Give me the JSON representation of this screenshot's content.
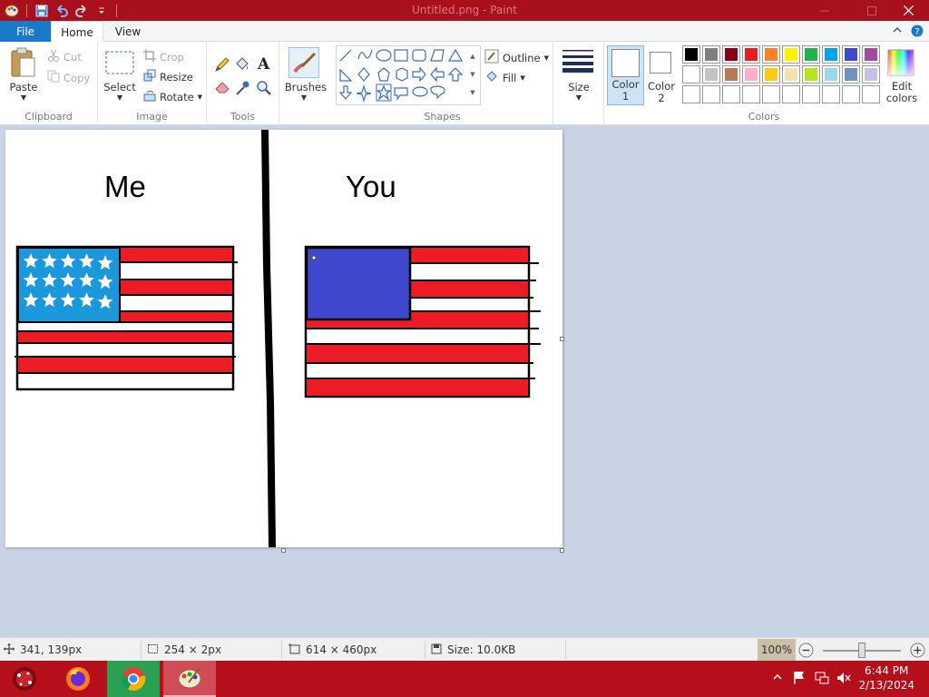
{
  "window": {
    "title": "Untitled.png - Paint",
    "controls": [
      "minimize",
      "maximize",
      "close"
    ]
  },
  "tabs": [
    {
      "label": "File"
    },
    {
      "label": "Home"
    },
    {
      "label": "View"
    }
  ],
  "ribbon": {
    "clipboard": {
      "label": "Clipboard",
      "paste": "Paste",
      "cut": "Cut",
      "copy": "Copy"
    },
    "image": {
      "label": "Image",
      "select": "Select",
      "crop": "Crop",
      "resize": "Resize",
      "rotate": "Rotate"
    },
    "tools": {
      "label": "Tools"
    },
    "brushes": {
      "label": "Brushes"
    },
    "shapes": {
      "label": "Shapes",
      "outline": "Outline",
      "fill": "Fill"
    },
    "size": {
      "label": "Size"
    },
    "color1": {
      "label": "Color",
      "num": "1",
      "color": "#ffffff"
    },
    "color2": {
      "label": "Color",
      "num": "2",
      "color": "#ffffff"
    },
    "colors": {
      "label": "Colors",
      "edit_line1": "Edit",
      "edit_line2": "colors"
    },
    "palette": [
      [
        "#000000",
        "#7f7f7f",
        "#880015",
        "#ed1c24",
        "#ff7f27",
        "#fff200",
        "#22b14c",
        "#00a2e8",
        "#3f48cc",
        "#a349a4"
      ],
      [
        "#ffffff",
        "#c3c3c3",
        "#b97a57",
        "#ffaec9",
        "#ffc90e",
        "#efe4b0",
        "#b5e61d",
        "#99d9ea",
        "#7092be",
        "#c8bfe7"
      ],
      [
        "#ffffff",
        "#ffffff",
        "#ffffff",
        "#ffffff",
        "#ffffff",
        "#ffffff",
        "#ffffff",
        "#ffffff",
        "#ffffff",
        "#ffffff"
      ]
    ]
  },
  "canvas": {
    "label_left": "Me",
    "label_right": "You"
  },
  "status": {
    "cursor_pos": "341, 139px",
    "selection_size": "254 × 2px",
    "image_size": "614 × 460px",
    "file_size": "Size: 10.0KB",
    "zoom": "100%",
    "zoom_level": 1.0
  },
  "taskbar": {
    "time": "6:44 PM",
    "date": "2/13/2024",
    "apps": [
      "start",
      "firefox",
      "chrome",
      "paint"
    ]
  },
  "colors": {
    "accent_file": "#1979ca",
    "titlebar": "#a8101c",
    "taskbar": "#b50f1b",
    "flag_red": "#ed1c24",
    "flag_blue_me": "#1b98dc",
    "flag_blue_you": "#3f48cc"
  }
}
